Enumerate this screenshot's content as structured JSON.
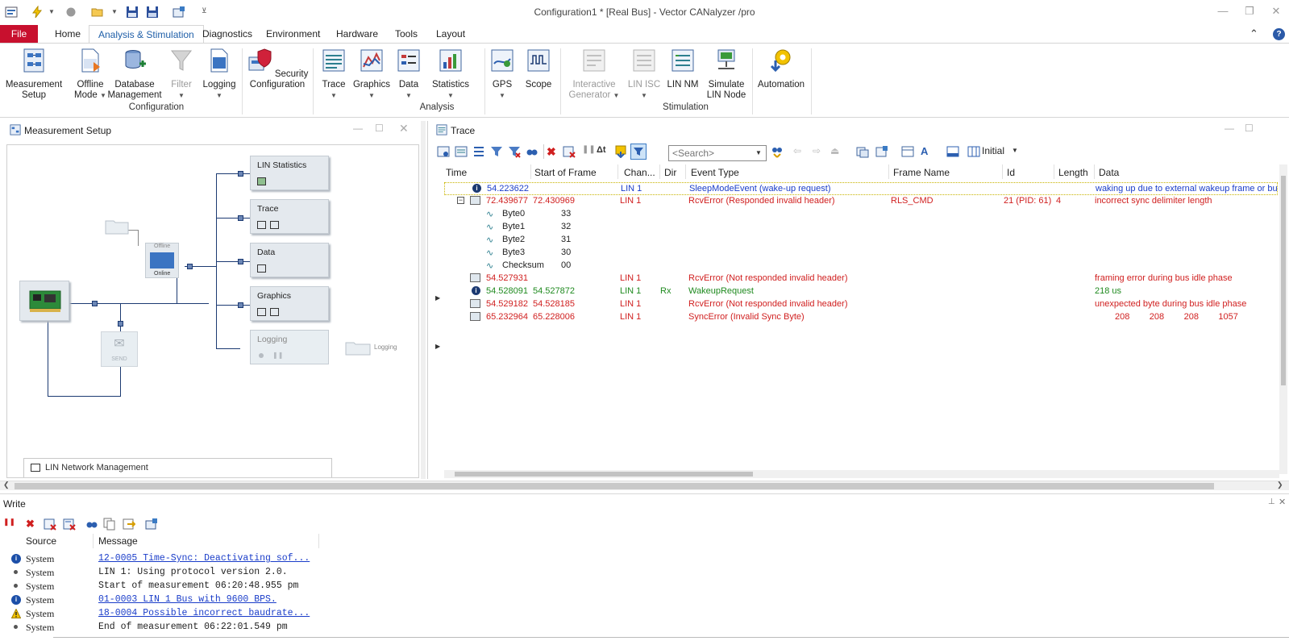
{
  "window": {
    "title": "Configuration1 * [Real Bus] - Vector CANalyzer /pro",
    "minimize": "—",
    "restore": "❐",
    "close": "✕"
  },
  "tabs": [
    {
      "label": "File"
    },
    {
      "label": "Home"
    },
    {
      "label": "Analysis & Stimulation"
    },
    {
      "label": "Diagnostics"
    },
    {
      "label": "Environment"
    },
    {
      "label": "Hardware"
    },
    {
      "label": "Tools"
    },
    {
      "label": "Layout"
    }
  ],
  "ribbon": {
    "collapse": "⌃",
    "help": "?",
    "buttons": [
      {
        "line1": "Measurement",
        "line2": "Setup",
        "icon": "measurement-setup-icon"
      },
      {
        "line1": "Offline",
        "line2": "Mode",
        "icon": "offline-mode-icon"
      },
      {
        "line1": "Database",
        "line2": "Management",
        "icon": "database-icon"
      },
      {
        "line1": "Filter",
        "line2": "",
        "icon": "filter-icon"
      },
      {
        "line1": "Logging",
        "line2": "",
        "icon": "logging-icon"
      },
      {
        "line1": "Security",
        "line2": "Configuration",
        "icon": "security-icon"
      },
      {
        "line1": "Trace",
        "line2": "",
        "icon": "trace-icon"
      },
      {
        "line1": "Graphics",
        "line2": "",
        "icon": "graphics-icon"
      },
      {
        "line1": "Data",
        "line2": "",
        "icon": "data-icon"
      },
      {
        "line1": "Statistics",
        "line2": "",
        "icon": "statistics-icon"
      },
      {
        "line1": "GPS",
        "line2": "",
        "icon": "gps-icon"
      },
      {
        "line1": "Scope",
        "line2": "",
        "icon": "scope-icon"
      },
      {
        "line1": "Interactive",
        "line2": "Generator",
        "icon": "interactive-generator-icon"
      },
      {
        "line1": "LIN ISC",
        "line2": "",
        "icon": "lin-isc-icon"
      },
      {
        "line1": "LIN NM",
        "line2": "",
        "icon": "lin-nm-icon"
      },
      {
        "line1": "Simulate",
        "line2": "LIN Node",
        "icon": "simulate-lin-node-icon"
      },
      {
        "line1": "Automation",
        "line2": "",
        "icon": "automation-icon"
      }
    ],
    "groups": [
      "Configuration",
      "Analysis",
      "Stimulation"
    ]
  },
  "measurement_setup": {
    "title": "Measurement Setup",
    "blocks": [
      "LIN Statistics",
      "Trace",
      "Data",
      "Graphics",
      "Logging"
    ],
    "offline_label": "Offline",
    "online_label": "Online",
    "send_label": "SEND",
    "logging_file_label": "Logging",
    "lin_nm_window": "LIN Network Management"
  },
  "trace": {
    "title": "Trace",
    "search_placeholder": "<Search>",
    "layout_label": "Initial",
    "columns": [
      "Time",
      "Start of Frame",
      "Chan...",
      "Dir",
      "Event Type",
      "Frame Name",
      "Id",
      "Length",
      "Data"
    ],
    "rows": [
      {
        "time": "54.223622",
        "sof": "",
        "chan": "LIN 1",
        "dir": "",
        "event": "SleepModeEvent (wake-up request)",
        "frame": "",
        "id": "",
        "len": "",
        "data": "waking up due to external wakeup frame or bu",
        "color": "blue"
      },
      {
        "time": "72.439677",
        "sof": "72.430969",
        "chan": "LIN 1",
        "dir": "",
        "event": "RcvError (Responded invalid header)",
        "frame": "RLS_CMD",
        "id": "21 (PID: 61)",
        "len": "4",
        "data": "incorrect sync delimiter length",
        "color": "red"
      },
      {
        "time": "54.527931",
        "sof": "",
        "chan": "LIN 1",
        "dir": "",
        "event": "RcvError (Not responded invalid header)",
        "frame": "",
        "id": "",
        "len": "",
        "data": "framing error during bus idle phase",
        "color": "red"
      },
      {
        "time": "54.528091",
        "sof": "54.527872",
        "chan": "LIN 1",
        "dir": "Rx",
        "event": "WakeupRequest",
        "frame": "",
        "id": "",
        "len": "",
        "data": "218 us",
        "color": "green"
      },
      {
        "time": "54.529182",
        "sof": "54.528185",
        "chan": "LIN 1",
        "dir": "",
        "event": "RcvError (Not responded invalid header)",
        "frame": "",
        "id": "",
        "len": "",
        "data": "unexpected byte during bus idle phase",
        "color": "red"
      },
      {
        "time": "65.232964",
        "sof": "65.228006",
        "chan": "LIN 1",
        "dir": "",
        "event": "SyncError (Invalid Sync Byte)",
        "frame": "",
        "id": "",
        "len": "",
        "data": "208        208        208        1057",
        "color": "red"
      }
    ],
    "signals": [
      {
        "name": "Byte0",
        "value": "33"
      },
      {
        "name": "Byte1",
        "value": "32"
      },
      {
        "name": "Byte2",
        "value": "31"
      },
      {
        "name": "Byte3",
        "value": "30"
      },
      {
        "name": "Checksum",
        "value": "00"
      }
    ]
  },
  "write": {
    "title": "Write",
    "columns": [
      "Source",
      "Message"
    ],
    "rows": [
      {
        "icon": "info-icon",
        "source": "System",
        "message": "12-0005 Time-Sync: Deactivating sof...",
        "link": true
      },
      {
        "icon": "bullet-icon",
        "source": "System",
        "message": "LIN 1: Using protocol version 2.0.",
        "link": false
      },
      {
        "icon": "bullet-icon",
        "source": "System",
        "message": "Start of measurement 06:20:48.955 pm",
        "link": false
      },
      {
        "icon": "info-icon",
        "source": "System",
        "message": "01-0003 LIN 1 Bus with 9600 BPS.",
        "link": true
      },
      {
        "icon": "warning-icon",
        "source": "System",
        "message": "18-0004 Possible incorrect baudrate...",
        "link": true
      },
      {
        "icon": "bullet-icon",
        "source": "System",
        "message": "End of measurement 06:22:01.549 pm",
        "link": false
      }
    ]
  },
  "colors": {
    "file_tab": "#c8102e",
    "active_tab_text": "#1f5fa8",
    "error_red": "#d01f1f",
    "info_blue": "#1a3dc9",
    "rx_green": "#1f8a1f",
    "wire_navy": "#1c3a72"
  }
}
